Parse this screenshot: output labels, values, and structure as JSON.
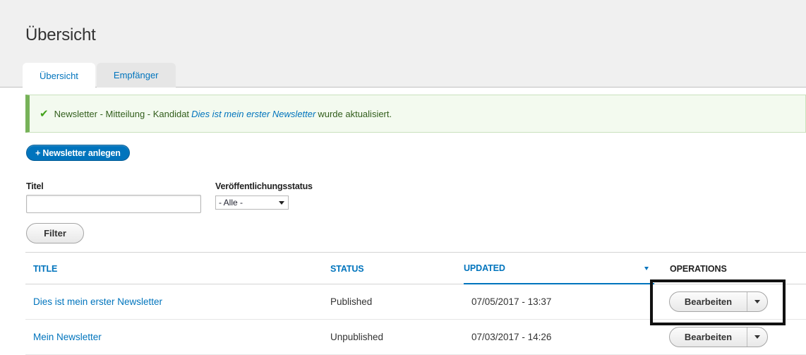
{
  "page": {
    "title": "Übersicht"
  },
  "tabs": [
    {
      "label": "Übersicht",
      "active": true
    },
    {
      "label": "Empfänger",
      "active": false
    }
  ],
  "message": {
    "icon": "checkmark-icon",
    "before": "Newsletter - Mitteilung - Kandidat",
    "link": "Dies ist mein erster Newsletter",
    "after": "wurde aktualisiert."
  },
  "actions": {
    "add_label": "+ Newsletter anlegen"
  },
  "filters": {
    "title_label": "Titel",
    "title_value": "",
    "status_label": "Veröffentlichungsstatus",
    "status_selected": "- Alle -",
    "filter_label": "Filter"
  },
  "table": {
    "headers": {
      "title": "Title",
      "status": "Status",
      "updated": "Updated",
      "operations": "Operations"
    },
    "sorted_column": "updated",
    "rows": [
      {
        "title": "Dies ist mein erster Newsletter",
        "status": "Published",
        "updated": "07/05/2017 - 13:37",
        "op_label": "Bearbeiten"
      },
      {
        "title": "Mein Newsletter",
        "status": "Unpublished",
        "updated": "07/03/2017 - 14:26",
        "op_label": "Bearbeiten"
      }
    ]
  },
  "colors": {
    "link": "#0074bd",
    "success": "#77b259",
    "highlight": "#111111"
  }
}
